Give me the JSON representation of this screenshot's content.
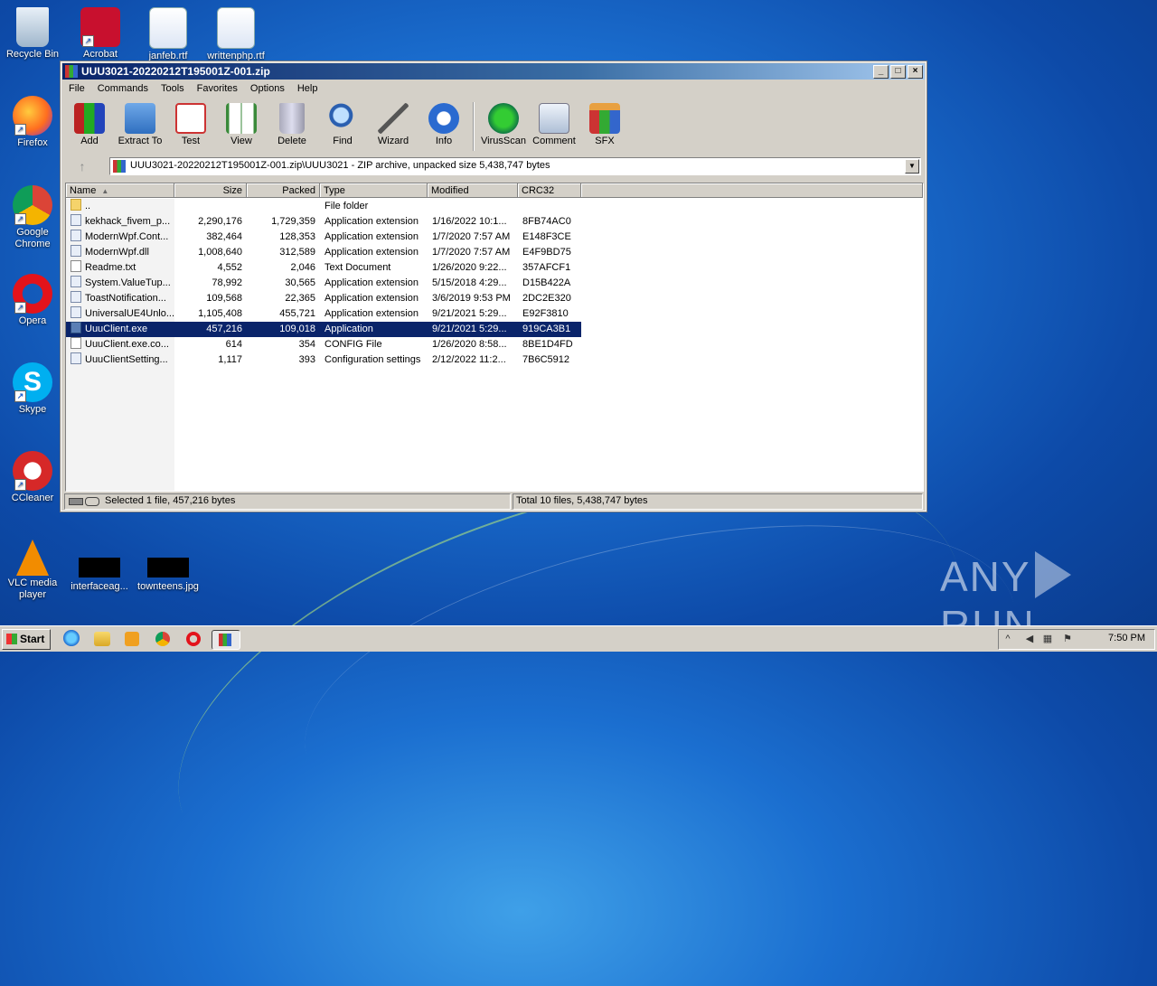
{
  "desktop": {
    "icons": [
      {
        "label": "Recycle Bin"
      },
      {
        "label": "Acrobat"
      },
      {
        "label": "janfeb.rtf"
      },
      {
        "label": "writtenphp.rtf"
      },
      {
        "label": "Firefox"
      },
      {
        "label": "Google Chrome"
      },
      {
        "label": "Opera"
      },
      {
        "label": "Skype"
      },
      {
        "label": "CCleaner"
      },
      {
        "label": "VLC media player"
      },
      {
        "label": "interfaceag..."
      },
      {
        "label": "townteens.jpg"
      }
    ],
    "watermark": {
      "left": "ANY",
      "right": "RUN"
    }
  },
  "window": {
    "title": "UUU3021-20220212T195001Z-001.zip",
    "controls": {
      "minimize": "_",
      "maximize": "□",
      "close": "×"
    },
    "menu": [
      "File",
      "Commands",
      "Tools",
      "Favorites",
      "Options",
      "Help"
    ],
    "toolbar": [
      {
        "label": "Add",
        "icon": "add-archive-icon"
      },
      {
        "label": "Extract To",
        "icon": "extract-folder-icon"
      },
      {
        "label": "Test",
        "icon": "test-checklist-icon"
      },
      {
        "label": "View",
        "icon": "view-book-icon"
      },
      {
        "label": "Delete",
        "icon": "trash-can-icon"
      },
      {
        "label": "Find",
        "icon": "magnifier-icon"
      },
      {
        "label": "Wizard",
        "icon": "magic-wand-icon"
      },
      {
        "label": "Info",
        "icon": "info-icon"
      },
      {
        "label": "VirusScan",
        "icon": "virus-scan-icon"
      },
      {
        "label": "Comment",
        "icon": "comment-icon"
      },
      {
        "label": "SFX",
        "icon": "sfx-box-icon"
      }
    ],
    "path": "UUU3021-20220212T195001Z-001.zip\\UUU3021 - ZIP archive, unpacked size 5,438,747 bytes",
    "columns": [
      "Name",
      "Size",
      "Packed",
      "Type",
      "Modified",
      "CRC32"
    ],
    "files": [
      {
        "name": "..",
        "size": "",
        "packed": "",
        "type": "File folder",
        "modified": "",
        "crc": "",
        "kind": "folder"
      },
      {
        "name": "kekhack_fivem_p...",
        "size": "2,290,176",
        "packed": "1,729,359",
        "type": "Application extension",
        "modified": "1/16/2022 10:1...",
        "crc": "8FB74AC0",
        "kind": "ext"
      },
      {
        "name": "ModernWpf.Cont...",
        "size": "382,464",
        "packed": "128,353",
        "type": "Application extension",
        "modified": "1/7/2020 7:57 AM",
        "crc": "E148F3CE",
        "kind": "ext"
      },
      {
        "name": "ModernWpf.dll",
        "size": "1,008,640",
        "packed": "312,589",
        "type": "Application extension",
        "modified": "1/7/2020 7:57 AM",
        "crc": "E4F9BD75",
        "kind": "ext"
      },
      {
        "name": "Readme.txt",
        "size": "4,552",
        "packed": "2,046",
        "type": "Text Document",
        "modified": "1/26/2020 9:22...",
        "crc": "357AFCF1",
        "kind": "txt"
      },
      {
        "name": "System.ValueTup...",
        "size": "78,992",
        "packed": "30,565",
        "type": "Application extension",
        "modified": "5/15/2018 4:29...",
        "crc": "D15B422A",
        "kind": "ext"
      },
      {
        "name": "ToastNotification...",
        "size": "109,568",
        "packed": "22,365",
        "type": "Application extension",
        "modified": "3/6/2019 9:53 PM",
        "crc": "2DC2E320",
        "kind": "ext"
      },
      {
        "name": "UniversalUE4Unlo...",
        "size": "1,105,408",
        "packed": "455,721",
        "type": "Application extension",
        "modified": "9/21/2021 5:29...",
        "crc": "E92F3810",
        "kind": "ext"
      },
      {
        "name": "UuuClient.exe",
        "size": "457,216",
        "packed": "109,018",
        "type": "Application",
        "modified": "9/21/2021 5:29...",
        "crc": "919CA3B1",
        "kind": "app",
        "selected": true
      },
      {
        "name": "UuuClient.exe.co...",
        "size": "614",
        "packed": "354",
        "type": "CONFIG File",
        "modified": "1/26/2020 8:58...",
        "crc": "8BE1D4FD",
        "kind": "txt"
      },
      {
        "name": "UuuClientSetting...",
        "size": "1,117",
        "packed": "393",
        "type": "Configuration settings",
        "modified": "2/12/2022 11:2...",
        "crc": "7B6C5912",
        "kind": "ext"
      }
    ],
    "status_left": "Selected 1 file, 457,216 bytes",
    "status_right": "Total 10 files, 5,438,747 bytes"
  },
  "taskbar": {
    "start_label": "Start",
    "clock": "7:50 PM"
  }
}
